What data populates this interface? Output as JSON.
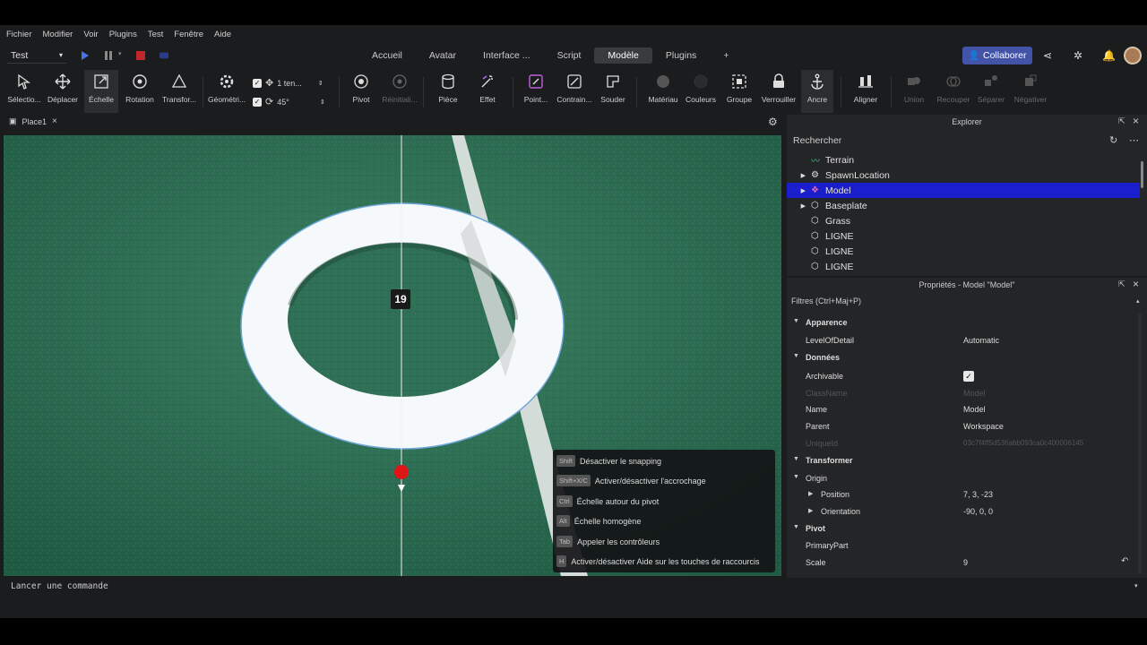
{
  "menu": [
    "Fichier",
    "Modifier",
    "Voir",
    "Plugins",
    "Test",
    "Fenêtre",
    "Aide"
  ],
  "test_selector": "Test",
  "tabs": [
    "Accueil",
    "Avatar",
    "Interface ...",
    "Script",
    "Modèle",
    "Plugins",
    "+"
  ],
  "active_tab": "Modèle",
  "collab_label": "Collaborer",
  "tools": {
    "select": "Sélectio...",
    "move": "Déplacer",
    "scale": "Échelle",
    "rotate": "Rotation",
    "transform": "Transfor...",
    "geometry": "Géométri...",
    "move_snap": "1 ten...",
    "rotate_snap": "45°",
    "pivot": "Pivot",
    "reset": "Réinitiali...",
    "part": "Pièce",
    "effect": "Effet",
    "point": "Point...",
    "constraint": "Contrain...",
    "weld": "Souder",
    "material": "Matériau",
    "colors": "Couleurs",
    "group": "Groupe",
    "lock": "Verrouiller",
    "anchor": "Ancre",
    "align": "Aligner",
    "union": "Union",
    "intersect": "Recouper",
    "separate": "Séparer",
    "negate": "Négativer"
  },
  "doc_tab": "Place1",
  "viewport": {
    "ring_number": "19",
    "hints": [
      {
        "key": "Shift",
        "label": "Désactiver le snapping"
      },
      {
        "key": "Shift+X/C",
        "label": "Activer/désactiver l'accrochage"
      },
      {
        "key": "Ctrl",
        "label": "Échelle autour du pivot"
      },
      {
        "key": "Alt",
        "label": "Échelle homogène"
      },
      {
        "key": "Tab",
        "label": "Appeler les contrôleurs"
      },
      {
        "key": "H",
        "label": "Activer/désactiver Aide sur les touches de raccourcis"
      }
    ]
  },
  "explorer": {
    "title": "Explorer",
    "search_placeholder": "Rechercher",
    "items": [
      {
        "label": "Terrain",
        "icon": "terrain-icon",
        "expandable": false
      },
      {
        "label": "SpawnLocation",
        "icon": "spawn-icon",
        "expandable": true
      },
      {
        "label": "Model",
        "icon": "model-icon",
        "expandable": true,
        "selected": true
      },
      {
        "label": "Baseplate",
        "icon": "part-icon",
        "expandable": true
      },
      {
        "label": "Grass",
        "icon": "part-icon",
        "expandable": false
      },
      {
        "label": "LIGNE",
        "icon": "part-icon",
        "expandable": false
      },
      {
        "label": "LIGNE",
        "icon": "part-icon",
        "expandable": false
      },
      {
        "label": "LIGNE",
        "icon": "part-icon",
        "expandable": false
      }
    ]
  },
  "properties": {
    "title": "Propriétés - Model \"Model\"",
    "filter_placeholder": "Filtres (Ctrl+Maj+P)",
    "rows": [
      {
        "type": "section",
        "name": "Apparence"
      },
      {
        "type": "prop",
        "name": "LevelOfDetail",
        "value": "Automatic"
      },
      {
        "type": "section",
        "name": "Données"
      },
      {
        "type": "check",
        "name": "Archivable",
        "value": "✓"
      },
      {
        "type": "dim",
        "name": "ClassName",
        "value": "Model"
      },
      {
        "type": "prop",
        "name": "Name",
        "value": "Model"
      },
      {
        "type": "prop",
        "name": "Parent",
        "value": "Workspace"
      },
      {
        "type": "dim",
        "name": "UniqueId",
        "value": "03c7f4ff5d536abb093ca0c400006145"
      },
      {
        "type": "section",
        "name": "Transformer"
      },
      {
        "type": "sub",
        "name": "Origin",
        "value": ""
      },
      {
        "type": "subsub",
        "name": "Position",
        "value": "7, 3, -23"
      },
      {
        "type": "subsub",
        "name": "Orientation",
        "value": "-90, 0, 0"
      },
      {
        "type": "section",
        "name": "Pivot"
      },
      {
        "type": "prop",
        "name": "PrimaryPart",
        "value": ""
      },
      {
        "type": "prop",
        "name": "Scale",
        "value": "9"
      }
    ]
  },
  "command_placeholder": "Lancer une commande",
  "colors": {
    "accent": "#4353a8",
    "selection": "#1a1ecc",
    "grass": "#2f6f55"
  }
}
